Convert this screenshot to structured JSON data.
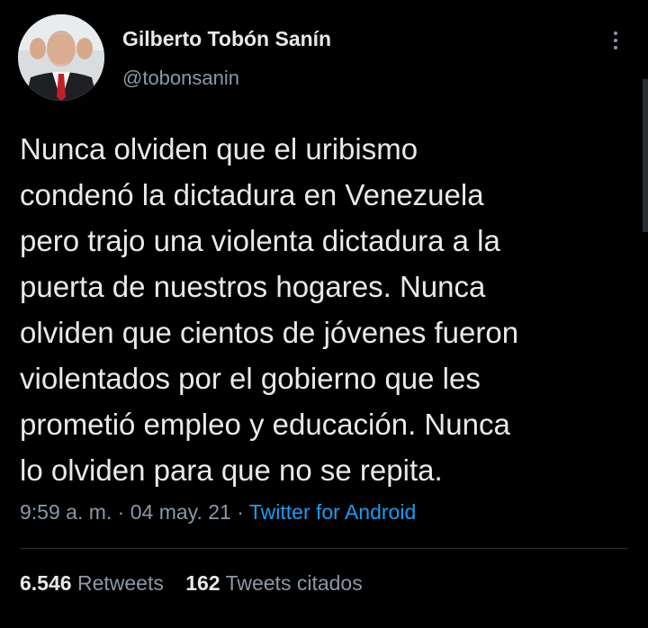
{
  "author": {
    "display_name": "Gilberto Tobón Sanín",
    "handle": "@tobonsanin"
  },
  "tweet": {
    "lines": [
      "Nunca olviden que el uribismo",
      "condenó la dictadura en Venezuela",
      "pero trajo una violenta dictadura a la",
      "puerta de nuestros hogares. Nunca",
      "olviden que cientos de jóvenes fueron",
      "violentados por el gobierno que les",
      "prometió empleo y educación. Nunca",
      "lo olviden para que no se repita."
    ],
    "time": "9:59 a. m.",
    "date": "04 may. 21",
    "separator": "·",
    "source": "Twitter for Android"
  },
  "stats": {
    "retweets_count": "6.546",
    "retweets_label": "Retweets",
    "quotes_count": "162",
    "quotes_label": "Tweets citados"
  },
  "icons": {
    "more": "more-vertical-icon"
  },
  "colors": {
    "background": "#000000",
    "text": "#e7e9ea",
    "secondary_text": "#8b98a5",
    "link": "#1d9bf0",
    "divider": "#2f3336"
  }
}
